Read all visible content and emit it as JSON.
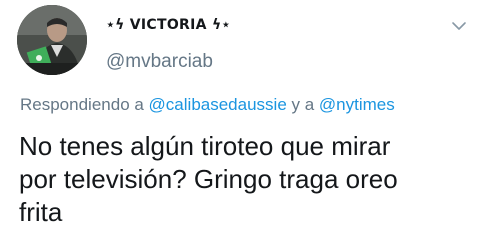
{
  "author": {
    "display_name": "⋆ϟ VICTORIA ϟ⋆",
    "handle": "@mvbarciab",
    "avatar_icon": "profile-photo"
  },
  "menu": {
    "icon": "chevron-down-icon"
  },
  "reply": {
    "prefix": "Respondiendo a ",
    "mention_1": "@calibasedaussie",
    "connector": " y a ",
    "mention_2": "@nytimes"
  },
  "tweet": {
    "lines": [
      "No tenes algún tiroteo que mirar",
      "por televisión? Gringo traga oreo",
      "frita"
    ]
  },
  "colors": {
    "text": "#14171a",
    "secondary": "#657786",
    "link": "#1b95e0"
  }
}
